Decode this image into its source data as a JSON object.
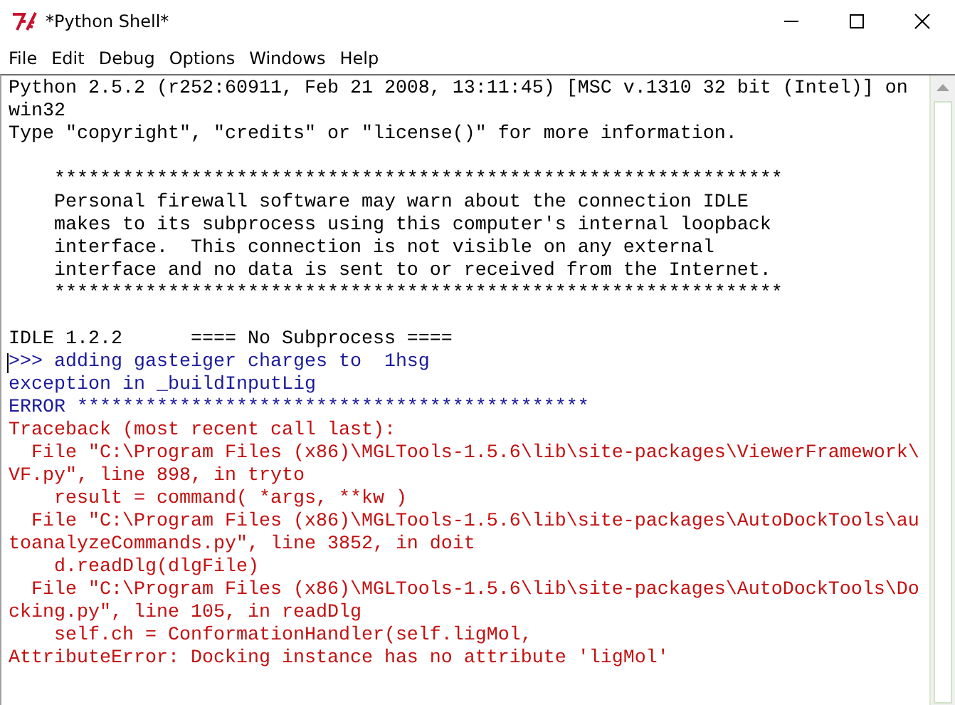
{
  "window": {
    "title": "*Python Shell*"
  },
  "menu": [
    "File",
    "Edit",
    "Debug",
    "Options",
    "Windows",
    "Help"
  ],
  "lines": [
    {
      "kind": "plain",
      "text": "Python 2.5.2 (r252:60911, Feb 21 2008, 13:11:45) [MSC v.1310 32 bit (Intel)] on"
    },
    {
      "kind": "plain",
      "text": "win32"
    },
    {
      "kind": "plain",
      "text": "Type \"copyright\", \"credits\" or \"license()\" for more information."
    },
    {
      "kind": "blank"
    },
    {
      "kind": "plain",
      "text": "    ****************************************************************"
    },
    {
      "kind": "plain",
      "text": "    Personal firewall software may warn about the connection IDLE"
    },
    {
      "kind": "plain",
      "text": "    makes to its subprocess using this computer's internal loopback"
    },
    {
      "kind": "plain",
      "text": "    interface.  This connection is not visible on any external"
    },
    {
      "kind": "plain",
      "text": "    interface and no data is sent to or received from the Internet."
    },
    {
      "kind": "plain",
      "text": "    ****************************************************************"
    },
    {
      "kind": "blank"
    },
    {
      "kind": "plain",
      "text": "IDLE 1.2.2      ==== No Subprocess ===="
    },
    {
      "kind": "stdout",
      "text": ">>> adding gasteiger charges to  1hsg",
      "cursor": true
    },
    {
      "kind": "stdout",
      "text": "exception in _buildInputLig"
    },
    {
      "kind": "stdout",
      "text": "ERROR *********************************************"
    },
    {
      "kind": "stderr",
      "text": "Traceback (most recent call last):"
    },
    {
      "kind": "stderr",
      "text": "  File \"C:\\Program Files (x86)\\MGLTools-1.5.6\\lib\\site-packages\\ViewerFramework\\"
    },
    {
      "kind": "stderr",
      "text": "VF.py\", line 898, in tryto"
    },
    {
      "kind": "stderr",
      "text": "    result = command( *args, **kw )"
    },
    {
      "kind": "stderr",
      "text": "  File \"C:\\Program Files (x86)\\MGLTools-1.5.6\\lib\\site-packages\\AutoDockTools\\au"
    },
    {
      "kind": "stderr",
      "text": "toanalyzeCommands.py\", line 3852, in doit"
    },
    {
      "kind": "stderr",
      "text": "    d.readDlg(dlgFile)"
    },
    {
      "kind": "stderr",
      "text": "  File \"C:\\Program Files (x86)\\MGLTools-1.5.6\\lib\\site-packages\\AutoDockTools\\Do"
    },
    {
      "kind": "stderr",
      "text": "cking.py\", line 105, in readDlg"
    },
    {
      "kind": "stderr",
      "text": "    self.ch = ConformationHandler(self.ligMol,"
    },
    {
      "kind": "stderr",
      "text": "AttributeError: Docking instance has no attribute 'ligMol'"
    }
  ]
}
